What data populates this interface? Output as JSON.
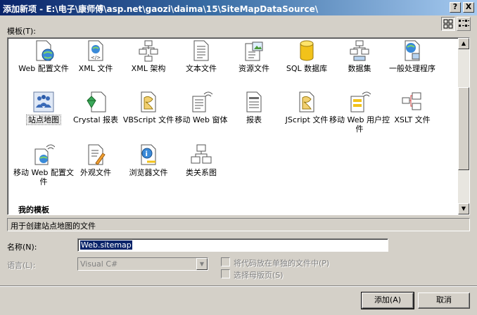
{
  "window": {
    "title": "添加新项 - E:\\电子\\康师傅\\asp.net\\gaozi\\daima\\15\\SiteMapDataSource\\",
    "help_button": "?",
    "close_button": "X"
  },
  "templates": {
    "label": "模板(T):",
    "items": [
      {
        "label": "Web 配置文件",
        "icon": "web-config-icon"
      },
      {
        "label": "XML 文件",
        "icon": "xml-file-icon"
      },
      {
        "label": "XML 架构",
        "icon": "xml-schema-icon"
      },
      {
        "label": "文本文件",
        "icon": "text-file-icon"
      },
      {
        "label": "资源文件",
        "icon": "resource-file-icon"
      },
      {
        "label": "SQL 数据库",
        "icon": "sql-database-icon"
      },
      {
        "label": "数据集",
        "icon": "dataset-icon"
      },
      {
        "label": "一般处理程序",
        "icon": "generic-handler-icon"
      },
      {
        "label": "站点地图",
        "icon": "site-map-icon",
        "selected": true
      },
      {
        "label": "Crystal 报表",
        "icon": "crystal-report-icon"
      },
      {
        "label": "VBScript 文件",
        "icon": "vbscript-file-icon"
      },
      {
        "label": "移动 Web 窗体",
        "icon": "mobile-web-form-icon"
      },
      {
        "label": "报表",
        "icon": "report-icon"
      },
      {
        "label": "JScript 文件",
        "icon": "jscript-file-icon"
      },
      {
        "label": "移动 Web 用户控件",
        "icon": "mobile-user-control-icon"
      },
      {
        "label": "XSLT 文件",
        "icon": "xslt-file-icon"
      },
      {
        "label": "移动 Web 配置文件",
        "icon": "mobile-web-config-icon"
      },
      {
        "label": "外观文件",
        "icon": "skin-file-icon"
      },
      {
        "label": "浏览器文件",
        "icon": "browser-file-icon"
      },
      {
        "label": "类关系图",
        "icon": "class-diagram-icon"
      }
    ],
    "my_templates": "我的模板",
    "description": "用于创建站点地图的文件"
  },
  "form": {
    "name_label": "名称(N):",
    "name_value": "Web.sitemap",
    "language_label": "语言(L):",
    "language_value": "Visual C#",
    "separate_code_label": "将代码放在单独的文件中(P)",
    "select_master_label": "选择母版页(S)"
  },
  "buttons": {
    "add": "添加(A)",
    "cancel": "取消"
  }
}
